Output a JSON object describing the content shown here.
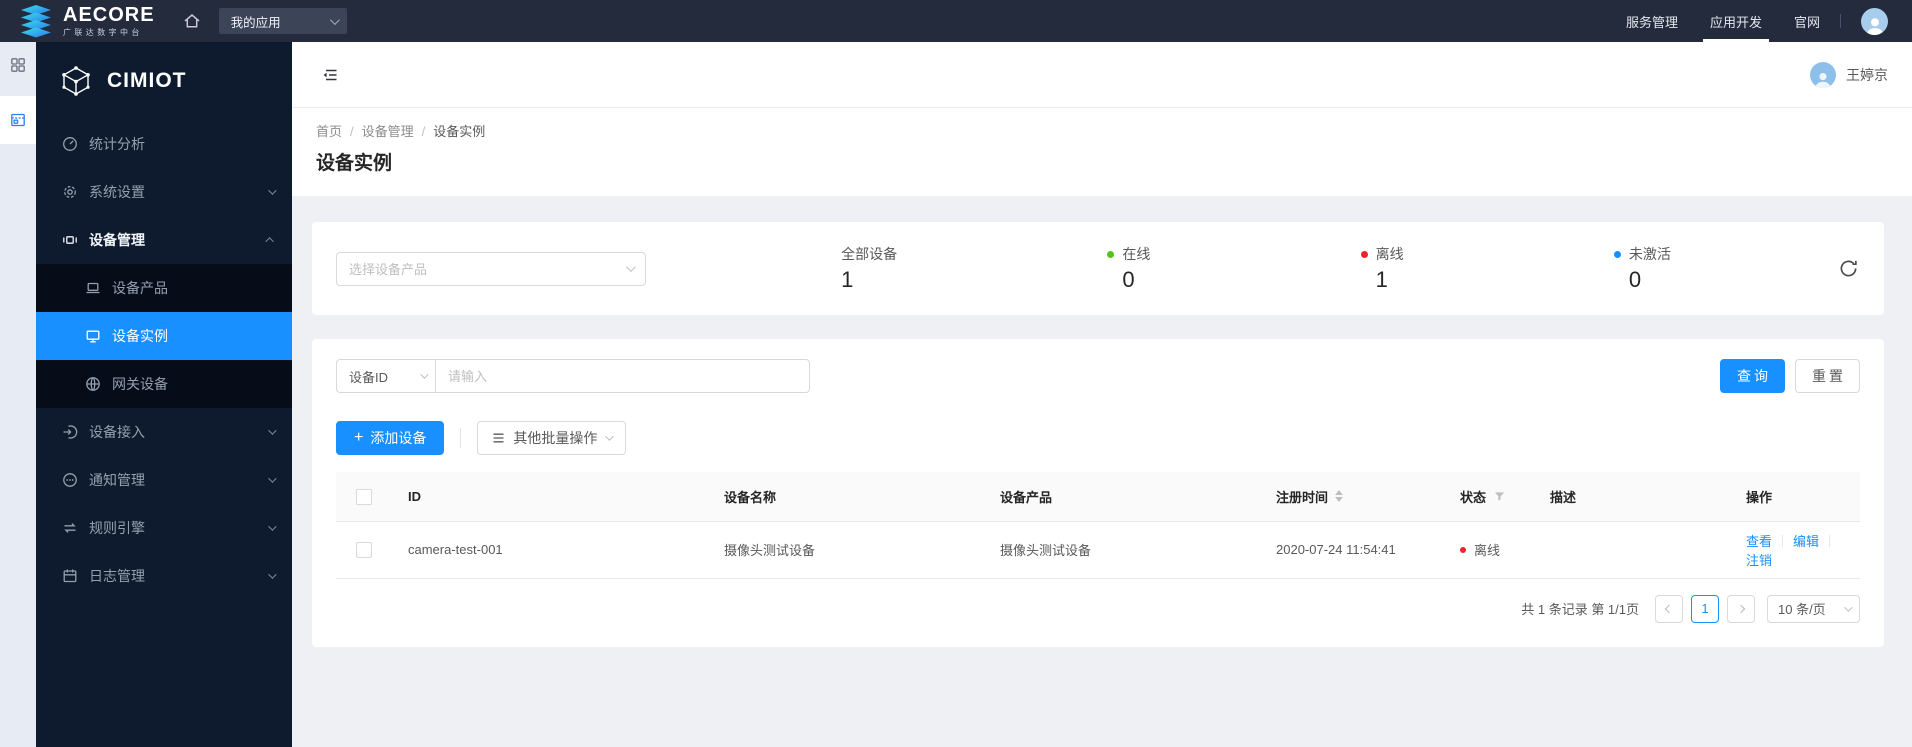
{
  "topbar": {
    "brand_name": "AECORE",
    "brand_subtitle": "广联达数字中台",
    "app_select_value": "我的应用",
    "nav": [
      {
        "label": "服务管理"
      },
      {
        "label": "应用开发"
      },
      {
        "label": "官网"
      }
    ]
  },
  "header": {
    "user_name": "王婷京"
  },
  "sidebar": {
    "logo_text": "CIMIOT",
    "items": [
      {
        "label": "统计分析",
        "icon": "gauge-icon"
      },
      {
        "label": "系统设置",
        "icon": "gear-icon"
      },
      {
        "label": "设备管理",
        "icon": "device-rack-icon"
      },
      {
        "label": "设备产品",
        "icon": "laptop-icon"
      },
      {
        "label": "设备实例",
        "icon": "monitor-icon"
      },
      {
        "label": "网关设备",
        "icon": "globe-icon"
      },
      {
        "label": "设备接入",
        "icon": "login-icon"
      },
      {
        "label": "通知管理",
        "icon": "comment-icon"
      },
      {
        "label": "规则引擎",
        "icon": "swap-icon"
      },
      {
        "label": "日志管理",
        "icon": "calendar-icon"
      }
    ]
  },
  "breadcrumb": {
    "separator": "/",
    "items": [
      "首页",
      "设备管理",
      "设备实例"
    ]
  },
  "page": {
    "title": "设备实例"
  },
  "overview": {
    "product_select_placeholder": "选择设备产品",
    "stats": [
      {
        "label": "全部设备",
        "value": "1"
      },
      {
        "label": "在线",
        "value": "0",
        "dot_color": "#52c41a"
      },
      {
        "label": "离线",
        "value": "1",
        "dot_color": "#f5222d"
      },
      {
        "label": "未激活",
        "value": "0",
        "dot_color": "#1890ff"
      }
    ]
  },
  "query": {
    "field_value": "设备ID",
    "input_placeholder": "请输入",
    "search_label": "查询",
    "reset_label": "重置"
  },
  "toolbar": {
    "add_icon": "+",
    "add_label": "添加设备",
    "bulk_label": "其他批量操作"
  },
  "table": {
    "headers": [
      "ID",
      "设备名称",
      "设备产品",
      "注册时间",
      "状态",
      "描述",
      "操作"
    ],
    "rows": [
      {
        "id": "camera-test-001",
        "name": "摄像头测试设备",
        "product": "摄像头测试设备",
        "registered_at": "2020-07-24 11:54:41",
        "status": "离线",
        "status_color": "#f5222d",
        "description": "",
        "actions": [
          "查看",
          "编辑",
          "注销"
        ]
      }
    ]
  },
  "pagination": {
    "total_text": "共 1 条记录 第 1/1页",
    "current_page": "1",
    "page_size": "10 条/页"
  },
  "colors": {
    "accent": "#1890ff",
    "online": "#52c41a",
    "offline": "#f5222d",
    "not_activated": "#1890ff",
    "topbar_bg": "#242b3d",
    "sidebar_bg": "#0e1b2e"
  }
}
